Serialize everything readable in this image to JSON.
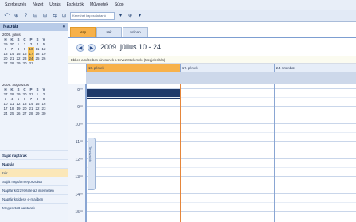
{
  "menubar": [
    "Szerkesztés",
    "Nézet",
    "Ugrás",
    "Eszközök",
    "Műveletek",
    "Súgó"
  ],
  "toolbar": {
    "items": [
      "⤺",
      "⊕",
      "?",
      "⊟",
      "⊞",
      "⇆",
      "⊡"
    ],
    "search_placeholder": "Kereshet kapcsolattartó",
    "tail": [
      "▾",
      "⊕",
      "▾"
    ]
  },
  "nav": {
    "header": "Naptár",
    "cal1": {
      "title": "2009. július",
      "dows": [
        "H",
        "K",
        "S",
        "C",
        "P",
        "S",
        "V"
      ],
      "rows": [
        [
          "29",
          "30",
          "1",
          "2",
          "3",
          "4",
          "5"
        ],
        [
          "6",
          "7",
          "8",
          "9",
          "10",
          "11",
          "12"
        ],
        [
          "13",
          "14",
          "15",
          "16",
          "17",
          "18",
          "19"
        ],
        [
          "20",
          "21",
          "22",
          "23",
          "24",
          "25",
          "26"
        ],
        [
          "27",
          "28",
          "29",
          "30",
          "31",
          "",
          ""
        ]
      ]
    },
    "cal2": {
      "title": "2009. augusztus",
      "dows": [
        "H",
        "K",
        "S",
        "C",
        "P",
        "S",
        "V"
      ],
      "rows": [
        [
          "27",
          "28",
          "29",
          "30",
          "31",
          "1",
          "2"
        ],
        [
          "3",
          "4",
          "5",
          "6",
          "7",
          "8",
          "9"
        ],
        [
          "10",
          "11",
          "12",
          "13",
          "14",
          "15",
          "16"
        ],
        [
          "17",
          "18",
          "19",
          "20",
          "21",
          "22",
          "23"
        ],
        [
          "24",
          "25",
          "26",
          "27",
          "28",
          "29",
          "30"
        ]
      ]
    },
    "items": [
      {
        "label": "Saját naptárak",
        "style": "bold"
      },
      {
        "label": "Naptár",
        "style": "bold"
      },
      {
        "label": "Kiir",
        "style": "sel"
      },
      {
        "label": "Saját naptár megosztása",
        "style": ""
      },
      {
        "label": "Naptár közzététele az interneten",
        "style": ""
      },
      {
        "label": "Naptár küldése e-mailben",
        "style": ""
      },
      {
        "label": "Megosztott naptárak",
        "style": ""
      }
    ]
  },
  "view": {
    "tabs": [
      "Nap",
      "Hét",
      "Hónap"
    ],
    "active_tab": 0,
    "prev": "◀",
    "next": "▶",
    "date_range": "2009. július 10 - 24",
    "info": "Ebben a nézetben nincsenek a tervezett elemek. (Megjelenítés)",
    "days": [
      {
        "label": "10.    péntek",
        "today": true
      },
      {
        "label": "17.    péntek",
        "today": false
      },
      {
        "label": "24.    szombat",
        "today": false
      }
    ],
    "times": [
      "8⁰⁰",
      "9⁰⁰",
      "10⁰⁰",
      "11⁰⁰",
      "12⁰⁰",
      "13⁰⁰",
      "14⁰⁰",
      "15⁰⁰"
    ],
    "side_tab": "Tennivalók"
  },
  "colors": {
    "accent": "#f7b14a",
    "header_blue": "#b8cbe8",
    "selection": "#1f3a6a"
  }
}
